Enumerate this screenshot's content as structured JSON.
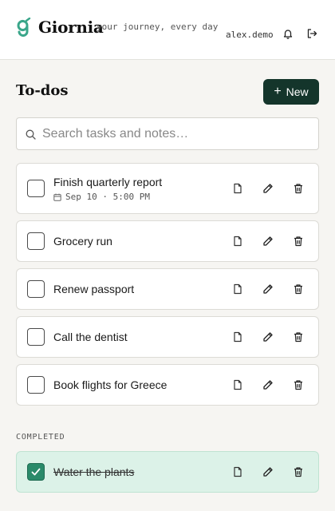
{
  "header": {
    "brand": "Giornia",
    "tagline": "your journey, every day",
    "username": "alex.demo",
    "icons": {
      "notifications": "bell-icon",
      "logout": "logout-icon"
    }
  },
  "page": {
    "title": "To-dos",
    "new_label": "New"
  },
  "search": {
    "placeholder": "Search tasks and notes…",
    "value": ""
  },
  "tasks": [
    {
      "label": "Finish quarterly report",
      "due": "Sep 10 · 5:00 PM",
      "done": false
    },
    {
      "label": "Grocery run",
      "done": false
    },
    {
      "label": "Renew passport",
      "done": false
    },
    {
      "label": "Call the dentist",
      "done": false
    },
    {
      "label": "Book flights for Greece",
      "done": false
    }
  ],
  "completed": {
    "heading": "COMPLETED",
    "tasks": [
      {
        "label": "Water the plants",
        "done": true
      }
    ]
  },
  "colors": {
    "accent": "#14352b",
    "logo": "#3aa68a",
    "completed_bg": "#dcf2e8",
    "check": "#2a8a6a"
  }
}
